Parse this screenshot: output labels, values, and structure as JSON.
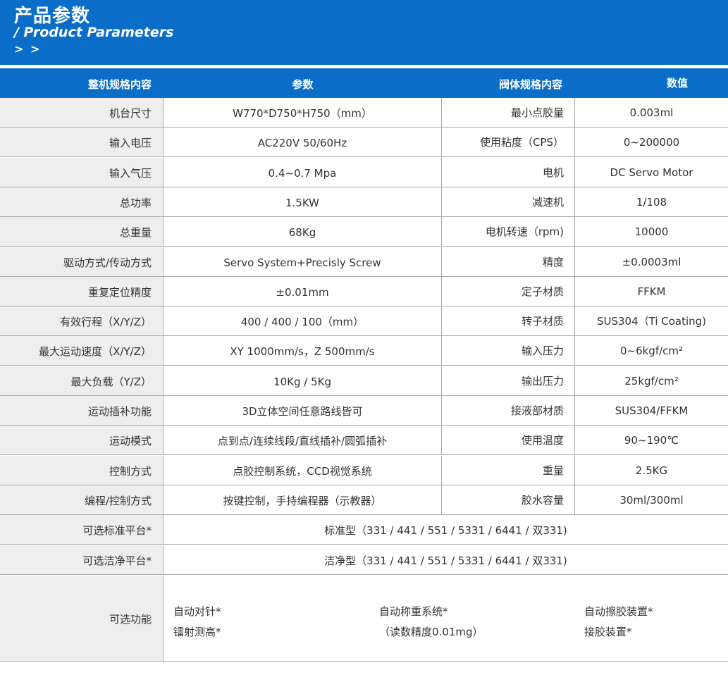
{
  "header": {
    "title_cn": "产品参数",
    "title_en": "/ Product Parameters",
    "arrows": "> >"
  },
  "table_header": [
    "整机规格内容",
    "参数",
    "阀体规格内容",
    "数值"
  ],
  "rows": [
    [
      "机台尺寸",
      "W770*D750*H750（mm）",
      "最小点胶量",
      "0.003ml"
    ],
    [
      "输入电压",
      "AC220V 50/60Hz",
      "使用粘度（CPS）",
      "0~200000"
    ],
    [
      "输入气压",
      "0.4~0.7 Mpa",
      "电机",
      "DC Servo Motor"
    ],
    [
      "总功率",
      "1.5KW",
      "减速机",
      "1/108"
    ],
    [
      "总重量",
      "68Kg",
      "电机转速（rpm)",
      "10000"
    ],
    [
      "驱动方式/传动方式",
      "Servo System+Precisly  Screw",
      "精度",
      "±0.0003ml"
    ],
    [
      "重复定位精度",
      "±0.01mm",
      "定子材质",
      "FFKM"
    ],
    [
      "有效行程（X/Y/Z）",
      "400 / 400 / 100（mm）",
      "转子材质",
      "SUS304（Ti Coating)"
    ],
    [
      "最大运动速度（X/Y/Z）",
      "XY 1000mm/s，Z 500mm/s",
      "输入压力",
      "0~6kgf/cm²"
    ],
    [
      "最大负载（Y/Z）",
      "10Kg / 5Kg",
      "输出压力",
      "25kgf/cm²"
    ],
    [
      "运动插补功能",
      "3D立体空间任意路线皆可",
      "接液部材质",
      "SUS304/FFKM"
    ],
    [
      "运动模式",
      "点到点/连续线段/直线插补/圆弧插补",
      "使用温度",
      "90~190℃"
    ],
    [
      "控制方式",
      "点胶控制系统，CCD视觉系统",
      "重量",
      "2.5KG"
    ],
    [
      "编程/控制方式",
      "按键控制，手持编程器（示教器）",
      "胶水容量",
      "30ml/300ml"
    ]
  ],
  "wide_rows": [
    [
      "可选标准平台*",
      "标准型（331 / 441 / 551 / 5331 / 6441 / 双331)"
    ],
    [
      "可选洁净平台*",
      "洁净型（331 / 441 / 551 / 5331 / 6441 / 双331)"
    ]
  ],
  "functions": {
    "label": "可选功能",
    "items": [
      "自动对针*",
      "镭射测高*",
      "自动称重系统*",
      "（读数精度0.01mg）",
      "自动擦胶装置*",
      "接胶装置*"
    ]
  }
}
